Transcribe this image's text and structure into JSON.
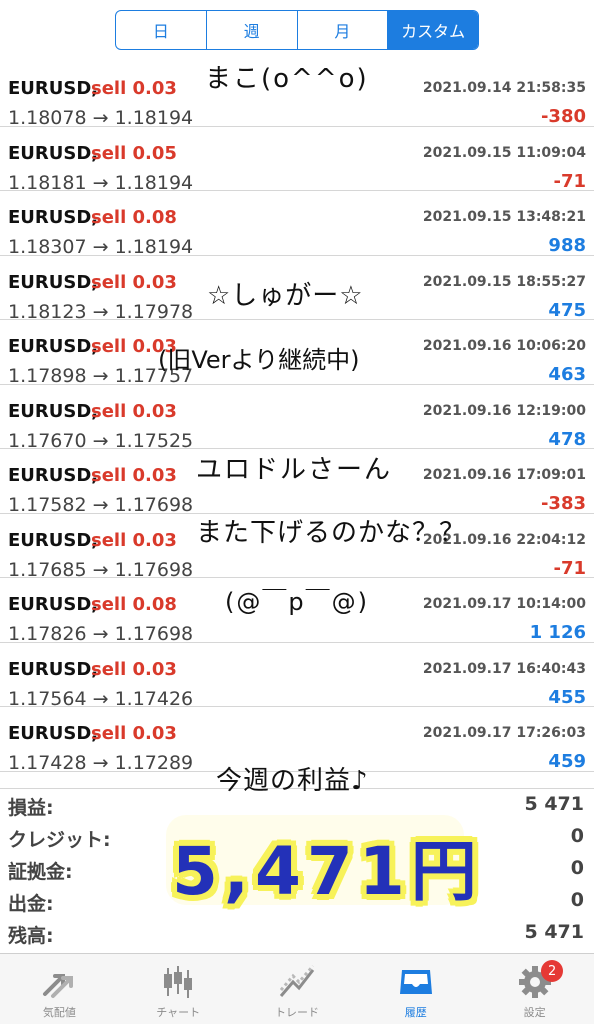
{
  "segmented": {
    "items": [
      {
        "label": "日",
        "active": false
      },
      {
        "label": "週",
        "active": false
      },
      {
        "label": "月",
        "active": false
      },
      {
        "label": "カスタム",
        "active": true
      }
    ]
  },
  "trades": [
    {
      "symbol": "EURUSD,",
      "side": "sell 0.03",
      "time": "2021.09.14 21:58:35",
      "prices": "1.18078 → 1.18194",
      "profit": "-380",
      "sign": "neg"
    },
    {
      "symbol": "EURUSD,",
      "side": "sell 0.05",
      "time": "2021.09.15 11:09:04",
      "prices": "1.18181 → 1.18194",
      "profit": "-71",
      "sign": "neg"
    },
    {
      "symbol": "EURUSD,",
      "side": "sell 0.08",
      "time": "2021.09.15 13:48:21",
      "prices": "1.18307 → 1.18194",
      "profit": "988",
      "sign": "pos"
    },
    {
      "symbol": "EURUSD,",
      "side": "sell 0.03",
      "time": "2021.09.15 18:55:27",
      "prices": "1.18123 → 1.17978",
      "profit": "475",
      "sign": "pos"
    },
    {
      "symbol": "EURUSD,",
      "side": "sell 0.03",
      "time": "2021.09.16 10:06:20",
      "prices": "1.17898 → 1.17757",
      "profit": "463",
      "sign": "pos"
    },
    {
      "symbol": "EURUSD,",
      "side": "sell 0.03",
      "time": "2021.09.16 12:19:00",
      "prices": "1.17670 → 1.17525",
      "profit": "478",
      "sign": "pos"
    },
    {
      "symbol": "EURUSD,",
      "side": "sell 0.03",
      "time": "2021.09.16 17:09:01",
      "prices": "1.17582 → 1.17698",
      "profit": "-383",
      "sign": "neg"
    },
    {
      "symbol": "EURUSD,",
      "side": "sell 0.03",
      "time": "2021.09.16 22:04:12",
      "prices": "1.17685 → 1.17698",
      "profit": "-71",
      "sign": "neg"
    },
    {
      "symbol": "EURUSD,",
      "side": "sell 0.08",
      "time": "2021.09.17 10:14:00",
      "prices": "1.17826 → 1.17698",
      "profit": "1 126",
      "sign": "pos"
    },
    {
      "symbol": "EURUSD,",
      "side": "sell 0.03",
      "time": "2021.09.17 16:40:43",
      "prices": "1.17564 → 1.17426",
      "profit": "455",
      "sign": "pos"
    },
    {
      "symbol": "EURUSD,",
      "side": "sell 0.03",
      "time": "2021.09.17 17:26:03",
      "prices": "1.17428 → 1.17289",
      "profit": "459",
      "sign": "pos"
    }
  ],
  "summary": [
    {
      "label": "損益:",
      "value": "5 471"
    },
    {
      "label": "クレジット:",
      "value": "0"
    },
    {
      "label": "証拠金:",
      "value": "0"
    },
    {
      "label": "出金:",
      "value": "0"
    },
    {
      "label": "残高:",
      "value": "5 471"
    }
  ],
  "handwriting": {
    "line1": "まこ(o^^o)",
    "line2": "☆しゅがー☆",
    "line3": "(旧Verより継続中)",
    "line4": "ユロドルさーん",
    "line5": "また下げるのかな？？",
    "line6": "(@￣p￣@)",
    "line7": "今週の利益♪",
    "big_profit": "5,471円"
  },
  "tabbar": {
    "items": [
      {
        "label": "気配値",
        "icon": "quotes-arrows-icon",
        "active": false
      },
      {
        "label": "チャート",
        "icon": "candlestick-chart-icon",
        "active": false
      },
      {
        "label": "トレード",
        "icon": "trade-line-icon",
        "active": false
      },
      {
        "label": "履歴",
        "icon": "history-tray-icon",
        "active": true
      },
      {
        "label": "設定",
        "icon": "gear-icon",
        "active": false,
        "badge": "2"
      }
    ]
  },
  "colors": {
    "accent": "#1d7de0",
    "negative": "#d93a2b",
    "highlight": "#f7f25a",
    "big_profit": "#2331b8"
  }
}
